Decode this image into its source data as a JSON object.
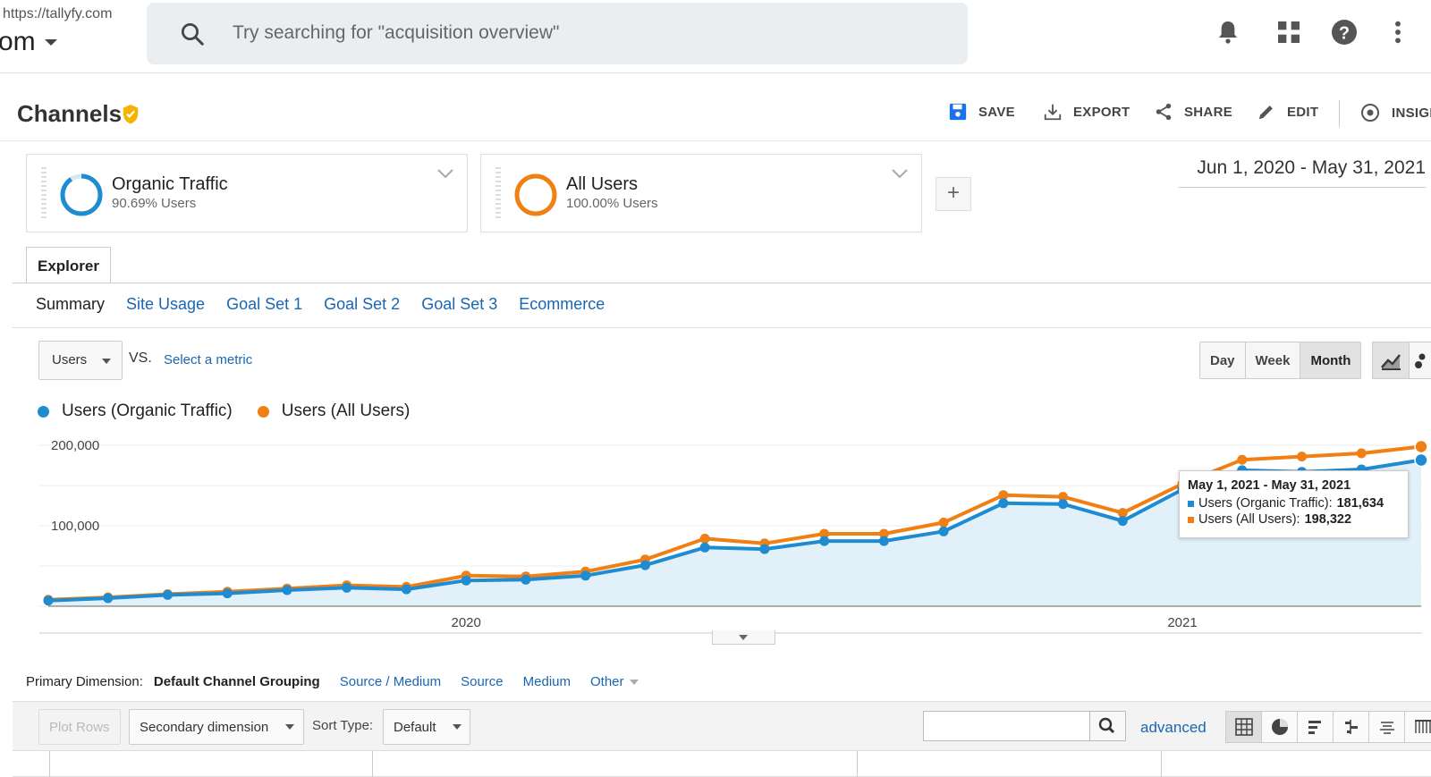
{
  "topbar": {
    "url": "https://tallyfy.com",
    "account": "om",
    "search_placeholder": "Try searching for \"acquisition overview\"",
    "icons": [
      "bell-icon",
      "apps-grid-icon",
      "help-icon",
      "more-vert-icon"
    ]
  },
  "report": {
    "title": "Channels",
    "actions": {
      "save": "SAVE",
      "export": "EXPORT",
      "share": "SHARE",
      "edit": "EDIT",
      "insights": "INSIGHTS"
    }
  },
  "segments": [
    {
      "name": "Organic Traffic",
      "sub": "90.69% Users",
      "color": "#1f8bd0"
    },
    {
      "name": "All Users",
      "sub": "100.00% Users",
      "color": "#f07f14"
    }
  ],
  "add_segment": "+",
  "date_range": "Jun 1, 2020 - May 31, 2021",
  "explorer_tab": "Explorer",
  "subtabs": {
    "summary": "Summary",
    "links": [
      "Site Usage",
      "Goal Set 1",
      "Goal Set 2",
      "Goal Set 3",
      "Ecommerce"
    ]
  },
  "metric": {
    "selected": "Users",
    "vs": "VS.",
    "select_metric": "Select a metric"
  },
  "granularity": {
    "options": [
      "Day",
      "Week",
      "Month"
    ],
    "active": "Month"
  },
  "legend": {
    "organic": "Users (Organic Traffic)",
    "all": "Users (All Users)"
  },
  "tooltip": {
    "date": "May 1, 2021 - May 31, 2021",
    "organic_label": "Users (Organic Traffic):",
    "organic_value": "181,634",
    "all_label": "Users (All Users):",
    "all_value": "198,322"
  },
  "chart_data": {
    "type": "area",
    "title": "",
    "xlabel": "",
    "ylabel": "",
    "y_ticks": [
      "200,000",
      "100,000"
    ],
    "ylim": [
      0,
      200000
    ],
    "x_ticks": [
      "2020",
      "2021"
    ],
    "x_tick_index": [
      7,
      19
    ],
    "series": [
      {
        "name": "Users (Organic Traffic)",
        "color": "#1f8bd0",
        "values": [
          7000,
          10000,
          14000,
          16000,
          20000,
          23000,
          21000,
          32000,
          33000,
          38000,
          51000,
          73000,
          71000,
          81000,
          81000,
          93000,
          128000,
          127000,
          106000,
          145000,
          169000,
          167000,
          170000,
          181634
        ]
      },
      {
        "name": "Users (All Users)",
        "color": "#f07f14",
        "values": [
          8000,
          11000,
          15000,
          18000,
          22000,
          26000,
          24000,
          38000,
          37000,
          43000,
          58000,
          84000,
          78000,
          90000,
          90000,
          104000,
          138000,
          136000,
          116000,
          152000,
          182000,
          186000,
          190000,
          198322
        ]
      }
    ]
  },
  "primary_dimension": {
    "label": "Primary Dimension:",
    "current": "Default Channel Grouping",
    "links": [
      "Source / Medium",
      "Source",
      "Medium"
    ],
    "other": "Other"
  },
  "table_tools": {
    "plot_rows": "Plot Rows",
    "secondary_dimension": "Secondary dimension",
    "sort_type_label": "Sort Type:",
    "sort_type_value": "Default",
    "advanced": "advanced"
  }
}
